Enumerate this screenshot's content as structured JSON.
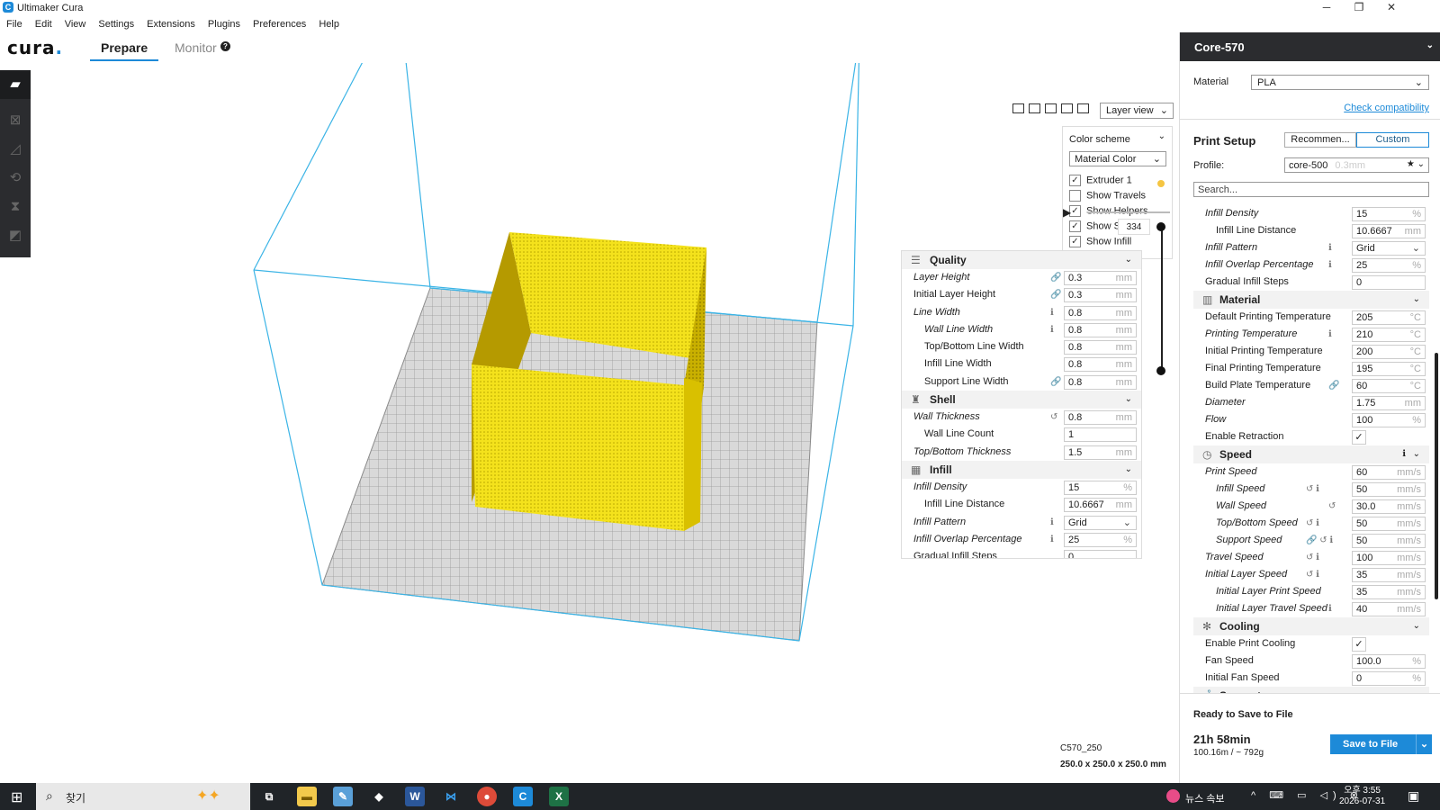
{
  "window": {
    "title": "Ultimaker Cura",
    "minimize": "─",
    "restore": "❐",
    "close": "✕",
    "app_icon": "C"
  },
  "menu": [
    "File",
    "Edit",
    "View",
    "Settings",
    "Extensions",
    "Plugins",
    "Preferences",
    "Help"
  ],
  "header": {
    "logo": "cura",
    "tabs": [
      "Prepare",
      "Monitor"
    ],
    "monitor_help": "?"
  },
  "toolbar": {
    "icons": [
      "open-folder-icon",
      "move-icon",
      "scale-icon",
      "rotate-icon",
      "mirror-icon",
      "per-model-settings-icon"
    ]
  },
  "view": {
    "view_mode": "Layer view",
    "color_scheme_label": "Color scheme",
    "color_scheme": "Material Color",
    "checks": [
      {
        "label": "Extruder 1",
        "checked": true
      },
      {
        "label": "Show Travels",
        "checked": false
      },
      {
        "label": "Show Helpers",
        "checked": true
      },
      {
        "label": "Show Shell",
        "checked": true
      },
      {
        "label": "Show Infill",
        "checked": true
      }
    ],
    "extruder_color": "#f5c542",
    "layer_number": "334",
    "play": "▶"
  },
  "quick_settings": {
    "rows": [
      {
        "type": "cat",
        "label": "Quality",
        "icon": "☰"
      },
      {
        "label": "Layer Height",
        "value": "0.3",
        "unit": "mm",
        "italic": true,
        "icon": "🔗"
      },
      {
        "label": "Initial Layer Height",
        "value": "0.3",
        "unit": "mm",
        "icon": "🔗"
      },
      {
        "label": "Line Width",
        "value": "0.8",
        "unit": "mm",
        "italic": true,
        "icon": "ℹ"
      },
      {
        "label": "Wall Line Width",
        "value": "0.8",
        "unit": "mm",
        "italic": true,
        "sub": true,
        "icon": "ℹ"
      },
      {
        "label": "Top/Bottom Line Width",
        "value": "0.8",
        "unit": "mm",
        "sub": true
      },
      {
        "label": "Infill Line Width",
        "value": "0.8",
        "unit": "mm",
        "sub": true
      },
      {
        "label": "Support Line Width",
        "value": "0.8",
        "unit": "mm",
        "sub": true,
        "icon": "🔗"
      },
      {
        "type": "cat",
        "label": "Shell",
        "icon": "♜"
      },
      {
        "label": "Wall Thickness",
        "value": "0.8",
        "unit": "mm",
        "italic": true,
        "icon": "↺"
      },
      {
        "label": "Wall Line Count",
        "value": "1",
        "unit": "",
        "sub": true
      },
      {
        "label": "Top/Bottom Thickness",
        "value": "1.5",
        "unit": "mm",
        "italic": true
      },
      {
        "type": "cat",
        "label": "Infill",
        "icon": "▦"
      },
      {
        "label": "Infill Density",
        "value": "15",
        "unit": "%",
        "italic": true
      },
      {
        "label": "Infill Line Distance",
        "value": "10.6667",
        "unit": "mm",
        "sub": true
      },
      {
        "label": "Infill Pattern",
        "value": "Grid",
        "select": true,
        "italic": true,
        "icon": "ℹ"
      },
      {
        "label": "Infill Overlap Percentage",
        "value": "25",
        "unit": "%",
        "italic": true,
        "icon": "ℹ"
      },
      {
        "label": "Gradual Infill Steps",
        "value": "0",
        "unit": ""
      }
    ]
  },
  "sidebar": {
    "printer": "Core-570",
    "material_label": "Material",
    "material": "PLA",
    "check_compat": "Check compatibility",
    "print_setup": "Print Setup",
    "recommended": "Recommen...",
    "custom": "Custom",
    "profile_label": "Profile:",
    "profile": "core-500",
    "profile_sub": "0.3mm",
    "search_placeholder": "Search...",
    "rows": [
      {
        "label": "Infill Density",
        "value": "15",
        "unit": "%",
        "italic": true
      },
      {
        "label": "Infill Line Distance",
        "value": "10.6667",
        "unit": "mm",
        "sub": true
      },
      {
        "label": "Infill Pattern",
        "value": "Grid",
        "select": true,
        "italic": true,
        "icon": "ℹ"
      },
      {
        "label": "Infill Overlap Percentage",
        "value": "25",
        "unit": "%",
        "italic": true,
        "icon": "ℹ"
      },
      {
        "label": "Gradual Infill Steps",
        "value": "0",
        "unit": ""
      },
      {
        "type": "cat",
        "label": "Material",
        "icon": "▥"
      },
      {
        "label": "Default Printing Temperature",
        "value": "205",
        "unit": "°C"
      },
      {
        "label": "Printing Temperature",
        "value": "210",
        "unit": "°C",
        "italic": true,
        "icon": "ℹ"
      },
      {
        "label": "Initial Printing Temperature",
        "value": "200",
        "unit": "°C"
      },
      {
        "label": "Final Printing Temperature",
        "value": "195",
        "unit": "°C"
      },
      {
        "label": "Build Plate Temperature",
        "value": "60",
        "unit": "°C",
        "icon": "🔗"
      },
      {
        "label": "Diameter",
        "value": "1.75",
        "unit": "mm",
        "italic": true
      },
      {
        "label": "Flow",
        "value": "100",
        "unit": "%",
        "italic": true
      },
      {
        "label": "Enable Retraction",
        "check": "✓"
      },
      {
        "type": "cat",
        "label": "Speed",
        "icon": "◷",
        "extra": "ℹ"
      },
      {
        "label": "Print Speed",
        "value": "60",
        "unit": "mm/s",
        "italic": true
      },
      {
        "label": "Infill Speed",
        "value": "50",
        "unit": "mm/s",
        "italic": true,
        "sub": true,
        "icon": "↺ ℹ"
      },
      {
        "label": "Wall Speed",
        "value": "30.0",
        "unit": "mm/s",
        "italic": true,
        "sub": true,
        "icon": "↺"
      },
      {
        "label": "Top/Bottom Speed",
        "value": "50",
        "unit": "mm/s",
        "italic": true,
        "sub": true,
        "icon": "↺ ℹ"
      },
      {
        "label": "Support Speed",
        "value": "50",
        "unit": "mm/s",
        "italic": true,
        "sub": true,
        "icon": "🔗 ↺ ℹ"
      },
      {
        "label": "Travel Speed",
        "value": "100",
        "unit": "mm/s",
        "italic": true,
        "icon": "↺ ℹ"
      },
      {
        "label": "Initial Layer Speed",
        "value": "35",
        "unit": "mm/s",
        "italic": true,
        "icon": "↺ ℹ"
      },
      {
        "label": "Initial Layer Print Speed",
        "value": "35",
        "unit": "mm/s",
        "italic": true,
        "sub": true
      },
      {
        "label": "Initial Layer Travel Speed",
        "value": "40",
        "unit": "mm/s",
        "italic": true,
        "sub": true,
        "icon": "ℹ"
      },
      {
        "type": "cat",
        "label": "Cooling",
        "icon": "✻"
      },
      {
        "label": "Enable Print Cooling",
        "check": "✓"
      },
      {
        "label": "Fan Speed",
        "value": "100.0",
        "unit": "%"
      },
      {
        "label": "Initial Fan Speed",
        "value": "0",
        "unit": "%"
      },
      {
        "type": "cat",
        "label": "Support",
        "icon": "⚓"
      }
    ],
    "ready": "Ready to Save to File",
    "time": "21h 58min",
    "detail": "100.16m / ~ 792g",
    "save": "Save to File"
  },
  "object": {
    "name": "C570_250",
    "dims": "250.0 x 250.0 x 250.0 mm"
  },
  "taskbar": {
    "search": "찾기",
    "news": "뉴스 속보",
    "time": "오후 3:55",
    "date": "2026-07-31"
  }
}
